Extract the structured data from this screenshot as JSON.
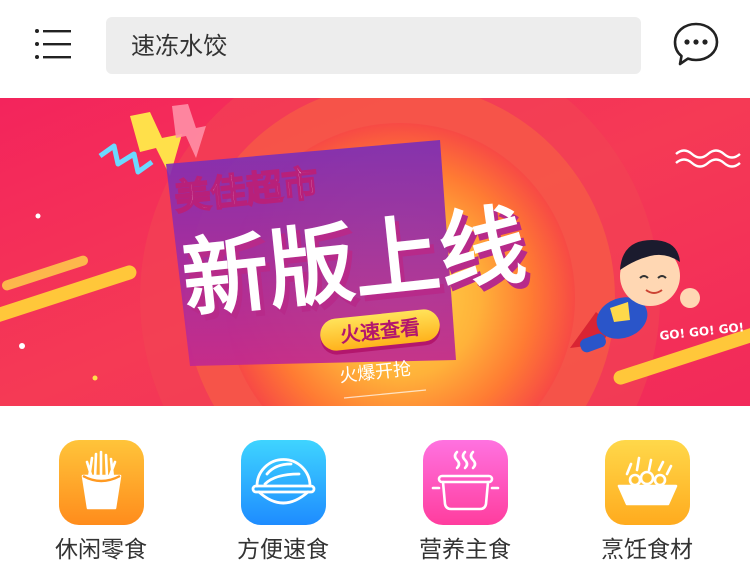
{
  "header": {
    "search_value": "速冻水饺",
    "menu_icon": "hamburger-menu-icon",
    "chat_icon": "chat-bubble-icon"
  },
  "banner": {
    "brand": "美佳超市",
    "headline": "新版上线",
    "cta": "火速查看",
    "subline": "火爆开抢",
    "mascot_text": "GO! GO! GO!"
  },
  "categories": [
    {
      "label": "休闲零食",
      "icon": "fries-icon",
      "color_top": "#ffc13a",
      "color_bottom": "#ff8a1c"
    },
    {
      "label": "方便速食",
      "icon": "bowl-icon",
      "color_top": "#3fd0ff",
      "color_bottom": "#1e8cff"
    },
    {
      "label": "营养主食",
      "icon": "pot-icon",
      "color_top": "#ff6fe0",
      "color_bottom": "#ff3d9e"
    },
    {
      "label": "烹饪食材",
      "icon": "basket-icon",
      "color_top": "#ffd84a",
      "color_bottom": "#ffab1e"
    }
  ],
  "colors": {
    "banner_red": "#f2295a",
    "banner_orange": "#ff7a2f",
    "banner_yellow": "#ffe04a"
  }
}
